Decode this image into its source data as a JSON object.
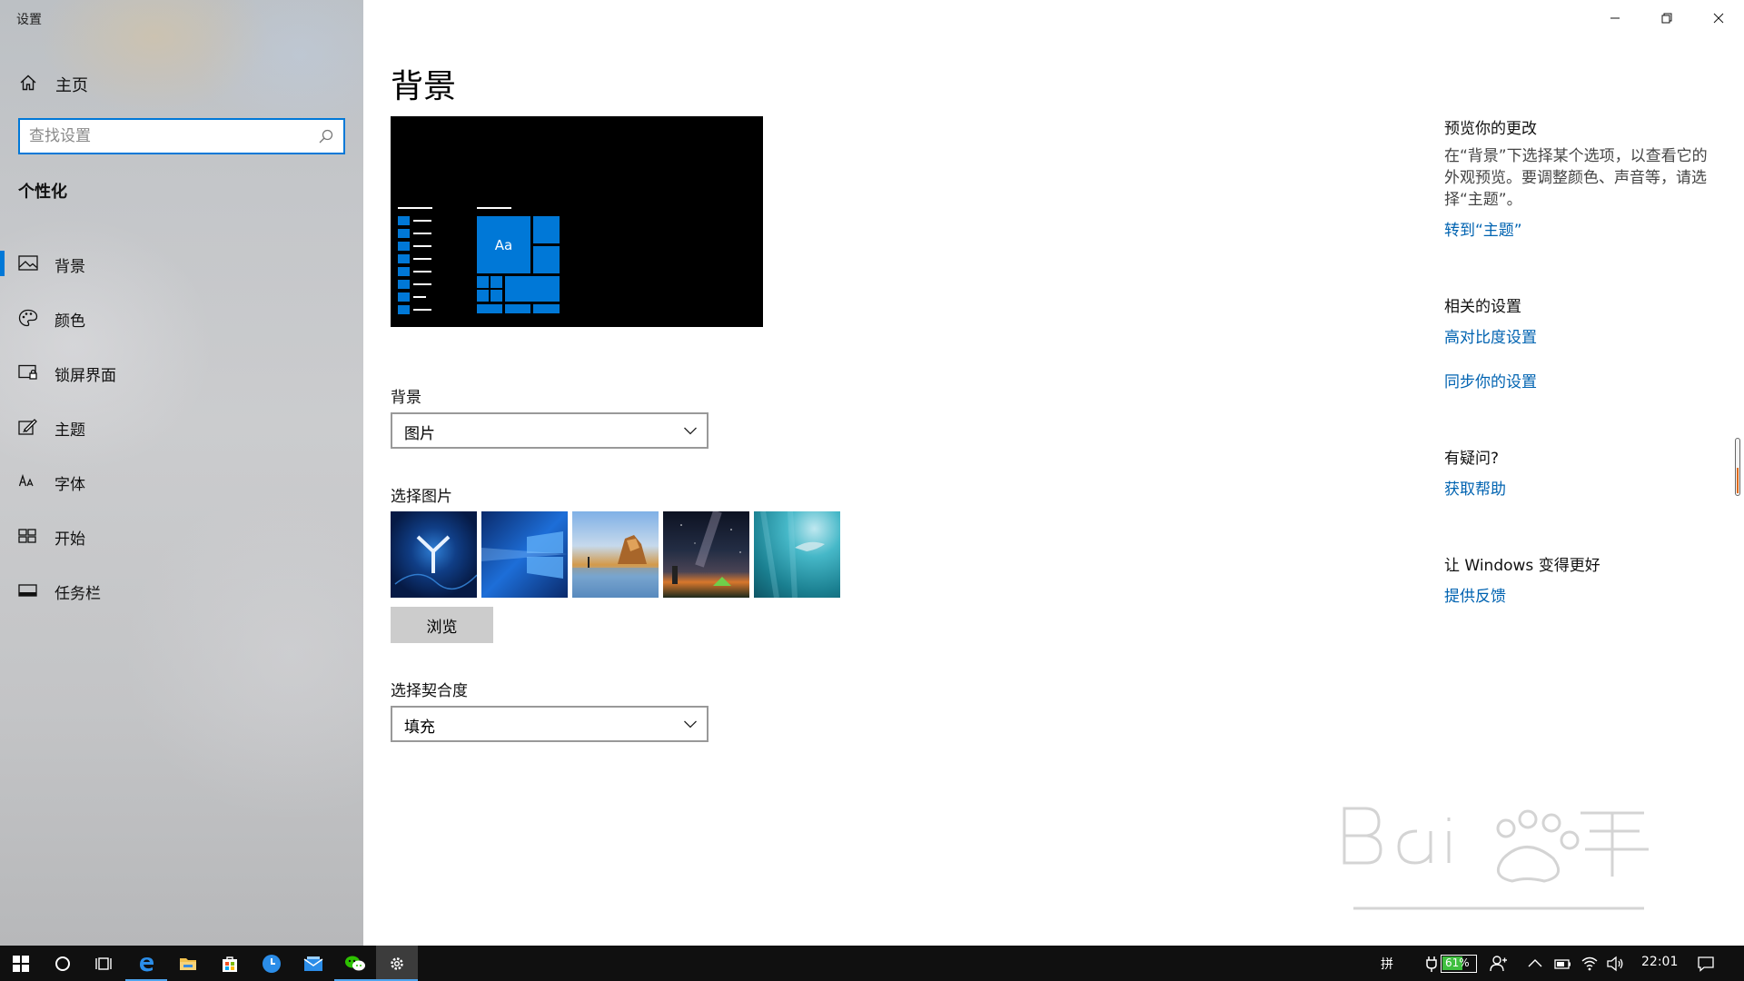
{
  "app": {
    "title": "设置"
  },
  "sidebar": {
    "home_label": "主页",
    "search_placeholder": "查找设置",
    "section_title": "个性化",
    "items": [
      {
        "label": "背景",
        "icon": "picture-icon",
        "active": true
      },
      {
        "label": "颜色",
        "icon": "palette-icon",
        "active": false
      },
      {
        "label": "锁屏界面",
        "icon": "lock-screen-icon",
        "active": false
      },
      {
        "label": "主题",
        "icon": "theme-brush-icon",
        "active": false
      },
      {
        "label": "字体",
        "icon": "font-icon",
        "active": false
      },
      {
        "label": "开始",
        "icon": "start-icon",
        "active": false
      },
      {
        "label": "任务栏",
        "icon": "taskbar-icon",
        "active": false
      }
    ]
  },
  "main": {
    "title": "背景",
    "preview": {
      "tile_text": "Aa"
    },
    "background": {
      "label": "背景",
      "value": "图片"
    },
    "choose_picture": {
      "label": "选择图片",
      "browse_label": "浏览"
    },
    "fit": {
      "label": "选择契合度",
      "value": "填充"
    }
  },
  "right": {
    "preview_changes": {
      "heading": "预览你的更改",
      "text": "在“背景”下选择某个选项，以查看它的外观预览。要调整颜色、声音等，请选择“主题”。",
      "link": "转到“主题”"
    },
    "related": {
      "heading": "相关的设置",
      "links": [
        "高对比度设置",
        "同步你的设置"
      ]
    },
    "help": {
      "heading": "有疑问?",
      "link": "获取帮助"
    },
    "feedback": {
      "heading": "让 Windows 变得更好",
      "link": "提供反馈"
    }
  },
  "taskbar": {
    "ime": "拼",
    "battery": "61%",
    "time": "22:01"
  },
  "colors": {
    "accent": "#0078d7",
    "link": "#0063b1"
  }
}
